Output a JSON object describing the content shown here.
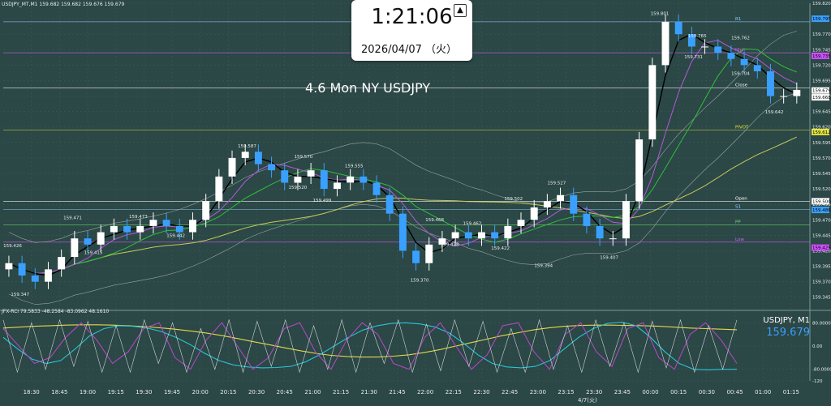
{
  "header": {
    "symbol_line": "USDJPY_MT,M1  159.682 159.682 159.676 159.679"
  },
  "clock": {
    "time": "1:21:06",
    "date": "2026/04/07 （火）",
    "up_icon": "eject-icon"
  },
  "colors": {
    "bg": "#2b4746",
    "grid": "#3f5f5e",
    "text": "#e8eeee",
    "bull": "#ffffff",
    "bear": "#3aa0ff",
    "black_ma": "#000000",
    "green_ma": "#2fbf3a",
    "purple_ma": "#b25ad8",
    "olive_ma": "#c8c85a",
    "band": "#9aa3a3",
    "level": "#9ad0ff",
    "pivot": "#e6e640",
    "stoch": "#cfd6d6",
    "rci_cyan": "#27c6d6",
    "rci_yellow": "#e6d84a",
    "rci_purple": "#b048c0"
  },
  "chart_data": [
    {
      "type": "candlestick",
      "symbol": "USDJPY",
      "timeframe": "M1",
      "annotation": "4.6 Mon NY USDJPY",
      "ylim": [
        159.325,
        159.82
      ],
      "y_ticks": [
        "159.820",
        "159.795",
        "159.770",
        "159.745",
        "159.720",
        "159.695",
        "159.670",
        "159.645",
        "159.620",
        "159.595",
        "159.570",
        "159.545",
        "159.520",
        "159.495",
        "159.470",
        "159.445",
        "159.420",
        "159.395",
        "159.370",
        "159.345"
      ],
      "x_ticks": [
        "18:30",
        "18:45",
        "19:00",
        "19:15",
        "19:30",
        "19:45",
        "20:00",
        "20:15",
        "20:30",
        "20:45",
        "21:00",
        "21:15",
        "21:30",
        "21:45",
        "22:00",
        "22:15",
        "22:30",
        "22:45",
        "23:00",
        "23:15",
        "23:30",
        "23:45",
        "00:00",
        "00:15",
        "00:30",
        "00:45",
        "01:00",
        "01:15"
      ],
      "date_label": "4/7(火)",
      "price_labels": [
        {
          "t": "18:20",
          "v": 159.426,
          "text": "159.426"
        },
        {
          "t": "18:24",
          "v": 159.347,
          "text": "159.347"
        },
        {
          "t": "18:52",
          "v": 159.471,
          "text": "159.471"
        },
        {
          "t": "19:03",
          "v": 159.415,
          "text": "159.415"
        },
        {
          "t": "19:27",
          "v": 159.473,
          "text": "159.473"
        },
        {
          "t": "19:47",
          "v": 159.442,
          "text": "159.442"
        },
        {
          "t": "20:25",
          "v": 159.587,
          "text": "159.587"
        },
        {
          "t": "20:55",
          "v": 159.57,
          "text": "159.570"
        },
        {
          "t": "20:52",
          "v": 159.52,
          "text": "159.520"
        },
        {
          "t": "21:05",
          "v": 159.499,
          "text": "159.499"
        },
        {
          "t": "21:22",
          "v": 159.555,
          "text": "159.555"
        },
        {
          "t": "21:57",
          "v": 159.37,
          "text": "159.370"
        },
        {
          "t": "22:05",
          "v": 159.468,
          "text": "159.468"
        },
        {
          "t": "22:13",
          "v": 159.428,
          "text": "159.428"
        },
        {
          "t": "22:25",
          "v": 159.462,
          "text": "159.462"
        },
        {
          "t": "22:40",
          "v": 159.422,
          "text": "159.422"
        },
        {
          "t": "22:47",
          "v": 159.502,
          "text": "159.502"
        },
        {
          "t": "23:03",
          "v": 159.394,
          "text": "159.394"
        },
        {
          "t": "23:10",
          "v": 159.527,
          "text": "159.527"
        },
        {
          "t": "23:38",
          "v": 159.407,
          "text": "159.407"
        },
        {
          "t": "00:05",
          "v": 159.801,
          "text": "159.801"
        },
        {
          "t": "00:25",
          "v": 159.765,
          "text": "159.765"
        },
        {
          "t": "00:23",
          "v": 159.731,
          "text": "159.731"
        },
        {
          "t": "00:48",
          "v": 159.762,
          "text": "159.762"
        },
        {
          "t": "00:48",
          "v": 159.704,
          "text": "159.704"
        },
        {
          "t": "01:06",
          "v": 159.642,
          "text": "159.642"
        }
      ],
      "levels": [
        {
          "name": "R1",
          "v": 159.79,
          "color": "#9ad0ff"
        },
        {
          "name": "High",
          "v": 159.74,
          "color": "#e060ff"
        },
        {
          "name": "Close",
          "v": 159.683,
          "color": "#ffffff"
        },
        {
          "name": "PIVOT",
          "v": 159.615,
          "color": "#e6e640"
        },
        {
          "name": "Open",
          "v": 159.5,
          "color": "#ffffff"
        },
        {
          "name": "S1",
          "v": 159.487,
          "color": "#9ad0ff"
        },
        {
          "name": "PP",
          "v": 159.462,
          "color": "#6ce06c"
        },
        {
          "name": "Low",
          "v": 159.434,
          "color": "#e060ff"
        }
      ],
      "axis_tags": [
        {
          "v": 159.795,
          "text": "159.795",
          "color": "#3aa0ff"
        },
        {
          "v": 159.735,
          "text": "159.735",
          "color": "#d050ff"
        },
        {
          "v": 159.679,
          "text": "159.679",
          "color": "#ffffff"
        },
        {
          "v": 159.668,
          "text": "159.668",
          "color": "#ffffff"
        },
        {
          "v": 159.612,
          "text": "159.612",
          "color": "#e6e640"
        },
        {
          "v": 159.5,
          "text": "159.500",
          "color": "#ffffff"
        },
        {
          "v": 159.486,
          "text": "159.486",
          "color": "#3aa0ff"
        },
        {
          "v": 159.425,
          "text": "159.425",
          "color": "#d050ff"
        }
      ],
      "candles_t": [
        "18:18",
        "18:25",
        "18:32",
        "18:39",
        "18:46",
        "18:53",
        "19:00",
        "19:07",
        "19:14",
        "19:21",
        "19:28",
        "19:35",
        "19:42",
        "19:49",
        "19:56",
        "20:03",
        "20:10",
        "20:17",
        "20:24",
        "20:31",
        "20:38",
        "20:45",
        "20:52",
        "20:59",
        "21:06",
        "21:13",
        "21:20",
        "21:27",
        "21:34",
        "21:41",
        "21:48",
        "21:55",
        "22:02",
        "22:09",
        "22:16",
        "22:23",
        "22:30",
        "22:37",
        "22:44",
        "22:51",
        "22:58",
        "23:05",
        "23:12",
        "23:19",
        "23:26",
        "23:33",
        "23:40",
        "23:47",
        "23:54",
        "00:01",
        "00:08",
        "00:15",
        "00:22",
        "00:29",
        "00:36",
        "00:43",
        "00:50",
        "00:57",
        "01:04",
        "01:11",
        "01:18"
      ],
      "candles_c": [
        159.4,
        159.38,
        159.37,
        159.39,
        159.41,
        159.44,
        159.43,
        159.45,
        159.46,
        159.45,
        159.46,
        159.47,
        159.46,
        159.45,
        159.47,
        159.5,
        159.54,
        159.57,
        159.58,
        159.56,
        159.55,
        159.53,
        159.54,
        159.55,
        159.52,
        159.53,
        159.54,
        159.53,
        159.51,
        159.48,
        159.42,
        159.4,
        159.43,
        159.44,
        159.45,
        159.44,
        159.45,
        159.44,
        159.46,
        159.47,
        159.49,
        159.5,
        159.51,
        159.48,
        159.46,
        159.44,
        159.44,
        159.5,
        159.6,
        159.72,
        159.79,
        159.77,
        159.75,
        159.75,
        159.74,
        159.73,
        159.72,
        159.71,
        159.67,
        159.67,
        159.68
      ]
    },
    {
      "type": "line",
      "title": "JFX-RCI 79.5833 -48.2584 -83.0962 48.1610",
      "legend_right": "USDJPY, M1",
      "price": "159.679",
      "ylim": [
        -120,
        120
      ],
      "y_ticks": [
        "80.0000",
        "0.00",
        "-80.0000",
        "-120"
      ],
      "series": [
        {
          "name": "RCI long",
          "color": "#e6d84a",
          "values": [
            62,
            65,
            68,
            70,
            72,
            73,
            73,
            72,
            70,
            67,
            63,
            58,
            52,
            45,
            36,
            26,
            15,
            5,
            -6,
            -16,
            -25,
            -32,
            -36,
            -38,
            -38,
            -35,
            -30,
            -22,
            -12,
            0,
            12,
            24,
            36,
            46,
            56,
            63,
            68,
            71,
            72,
            72,
            71,
            70,
            68,
            65,
            62,
            60,
            58,
            56
          ]
        },
        {
          "name": "RCI mid",
          "color": "#27c6d6",
          "values": [
            30,
            -10,
            -45,
            -60,
            -50,
            -10,
            35,
            60,
            70,
            68,
            62,
            50,
            30,
            5,
            -25,
            -50,
            -65,
            -72,
            -75,
            -74,
            -70,
            -55,
            -30,
            0,
            30,
            55,
            70,
            78,
            80,
            76,
            66,
            45,
            10,
            -30,
            -60,
            -72,
            -75,
            -70,
            -50,
            -10,
            30,
            60,
            78,
            82,
            70,
            30,
            -20,
            -60,
            -80,
            -82,
            -80,
            -80
          ]
        },
        {
          "name": "RCI short",
          "color": "#b048c0",
          "values": [
            60,
            0,
            -60,
            -40,
            30,
            80,
            20,
            -60,
            -20,
            60,
            80,
            -40,
            -80,
            20,
            80,
            0,
            -80,
            -40,
            60,
            80,
            -20,
            -80,
            20,
            80,
            40,
            -60,
            -80,
            30,
            80,
            0,
            -80,
            -30,
            70,
            80,
            -20,
            -80,
            40,
            80,
            -20,
            -70,
            60,
            80,
            -40,
            -80,
            40,
            80,
            20,
            -60
          ]
        },
        {
          "name": "Stoch",
          "color": "#cfd6d6",
          "values": [
            90,
            -90,
            80,
            -80,
            90,
            -70,
            85,
            -90,
            70,
            -90,
            90,
            -60,
            80,
            -90,
            60,
            -80,
            90,
            -90,
            85,
            -70,
            90,
            -90,
            70,
            -80,
            90,
            -90,
            80,
            -60,
            90,
            -90,
            75,
            -85,
            90,
            -70,
            85,
            -90,
            60,
            -90,
            90,
            -80,
            70,
            -90,
            90,
            -70,
            80,
            -90,
            85,
            -75,
            90,
            -90,
            70,
            -80,
            90
          ]
        }
      ]
    }
  ]
}
